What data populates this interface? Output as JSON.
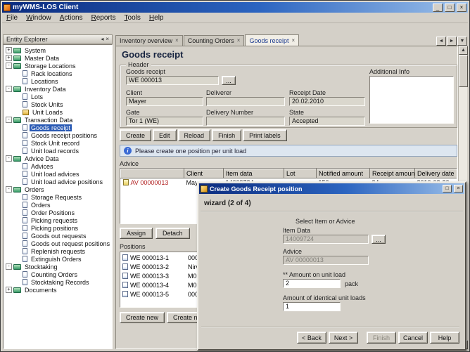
{
  "colors": {
    "selection": "#2a5ab4",
    "advice_id": "#b22222",
    "info_bar_bg": "#dde6f0",
    "titlebar_left": "#0b2b7e",
    "titlebar_right": "#9dc1ea"
  },
  "window": {
    "title": "myWMS-LOS Client",
    "menu": [
      "File",
      "Window",
      "Actions",
      "Reports",
      "Tools",
      "Help"
    ]
  },
  "explorer": {
    "title": "Entity Explorer",
    "tree": [
      {
        "label": "System",
        "level": 0,
        "toggle": "+",
        "icon": "folder"
      },
      {
        "label": "Master Data",
        "level": 0,
        "toggle": "+",
        "icon": "folder"
      },
      {
        "label": "Storage Locations",
        "level": 0,
        "toggle": "-",
        "icon": "folder"
      },
      {
        "label": "Rack locations",
        "level": 1,
        "icon": "doc"
      },
      {
        "label": "Locations",
        "level": 1,
        "icon": "doc"
      },
      {
        "label": "Inventory Data",
        "level": 0,
        "toggle": "-",
        "icon": "folder"
      },
      {
        "label": "Lots",
        "level": 1,
        "icon": "doc"
      },
      {
        "label": "Stock Units",
        "level": 1,
        "icon": "doc"
      },
      {
        "label": "Unit Loads",
        "level": 1,
        "icon": "box"
      },
      {
        "label": "Transaction Data",
        "level": 0,
        "toggle": "-",
        "icon": "folder"
      },
      {
        "label": "Goods receipt",
        "level": 1,
        "icon": "doc",
        "selected": true
      },
      {
        "label": "Goods receipt positions",
        "level": 1,
        "icon": "doc"
      },
      {
        "label": "Stock Unit record",
        "level": 1,
        "icon": "doc"
      },
      {
        "label": "Unit load records",
        "level": 1,
        "icon": "doc"
      },
      {
        "label": "Advice Data",
        "level": 0,
        "toggle": "-",
        "icon": "folder"
      },
      {
        "label": "Advices",
        "level": 1,
        "icon": "doc"
      },
      {
        "label": "Unit load advices",
        "level": 1,
        "icon": "doc"
      },
      {
        "label": "Unit load advice positions",
        "level": 1,
        "icon": "doc"
      },
      {
        "label": "Orders",
        "level": 0,
        "toggle": "-",
        "icon": "folder"
      },
      {
        "label": "Storage Requests",
        "level": 1,
        "icon": "doc"
      },
      {
        "label": "Orders",
        "level": 1,
        "icon": "doc"
      },
      {
        "label": "Order Positions",
        "level": 1,
        "icon": "doc"
      },
      {
        "label": "Picking requests",
        "level": 1,
        "icon": "doc"
      },
      {
        "label": "Picking positions",
        "level": 1,
        "icon": "doc"
      },
      {
        "label": "Goods out requests",
        "level": 1,
        "icon": "doc"
      },
      {
        "label": "Goods out request positions",
        "level": 1,
        "icon": "doc"
      },
      {
        "label": "Replenish requests",
        "level": 1,
        "icon": "doc"
      },
      {
        "label": "Extinguish Orders",
        "level": 1,
        "icon": "doc"
      },
      {
        "label": "Stocktaking",
        "level": 0,
        "toggle": "-",
        "icon": "folder"
      },
      {
        "label": "Counting Orders",
        "level": 1,
        "icon": "doc"
      },
      {
        "label": "Stocktaking Records",
        "level": 1,
        "icon": "doc"
      },
      {
        "label": "Documents",
        "level": 0,
        "toggle": "+",
        "icon": "folder"
      }
    ]
  },
  "tabs": [
    {
      "label": "Inventory overview",
      "active": false
    },
    {
      "label": "Counting Orders",
      "active": false
    },
    {
      "label": "Goods receipt",
      "active": true
    }
  ],
  "content": {
    "title": "Goods receipt",
    "header_group": {
      "title": "Header",
      "goods_receipt": {
        "label": "Goods receipt",
        "value": "WE 000013"
      },
      "client": {
        "label": "Client",
        "value": "Mayer"
      },
      "deliverer": {
        "label": "Deliverer",
        "value": ""
      },
      "receipt_date": {
        "label": "Receipt Date",
        "value": "20.02.2010"
      },
      "gate": {
        "label": "Gate",
        "value": "Tor 1 (WE)"
      },
      "delivery_number": {
        "label": "Delivery Number",
        "value": ""
      },
      "state": {
        "label": "State",
        "value": "Accepted"
      },
      "additional_info": {
        "label": "Additional Info",
        "value": ""
      }
    },
    "toolbar": [
      "Create",
      "Edit",
      "Reload",
      "Finish",
      "Print labels"
    ],
    "info_message": "Please create one position per unit load",
    "advice": {
      "label": "Advice",
      "columns": [
        "",
        "Client",
        "Item data",
        "Lot",
        "Notified amount",
        "Receipt amount",
        "Delivery date"
      ],
      "rows": [
        {
          "cells": [
            "AV 00000013",
            "Mayer",
            "14009724",
            "",
            "150",
            "34",
            "2010-02-20"
          ]
        }
      ],
      "buttons": [
        "Assign",
        "Detach"
      ]
    },
    "positions": {
      "label": "Positions",
      "rows": [
        {
          "id": "WE 000013-1",
          "item": "000..."
        },
        {
          "id": "WE 000013-2",
          "item": "Nirv..."
        },
        {
          "id": "WE 000013-3",
          "item": "M01..."
        },
        {
          "id": "WE 000013-4",
          "item": "M01..."
        },
        {
          "id": "WE 000013-5",
          "item": "000..."
        }
      ],
      "buttons": [
        "Create new",
        "Create new..."
      ]
    }
  },
  "dialog": {
    "title": "Create Goods Receipt position",
    "wizard_step": "wizard (2 of 4)",
    "section_title": "Select Item or Advice",
    "item_data": {
      "label": "Item Data",
      "value": "14009724"
    },
    "advice": {
      "label": "Advice",
      "value": "AV 00000013"
    },
    "amount": {
      "label": "** Amount on unit load",
      "value": "2",
      "unit": "pack"
    },
    "identical_loads": {
      "label": "Amount of identical unit loads",
      "value": "1"
    },
    "buttons": [
      {
        "label": "< Back",
        "disabled": false
      },
      {
        "label": "Next >",
        "disabled": false
      },
      {
        "label": "Finish",
        "disabled": true
      },
      {
        "label": "Cancel",
        "disabled": false
      },
      {
        "label": "Help",
        "disabled": false
      }
    ]
  },
  "misc": {
    "ellipsis": "..."
  }
}
